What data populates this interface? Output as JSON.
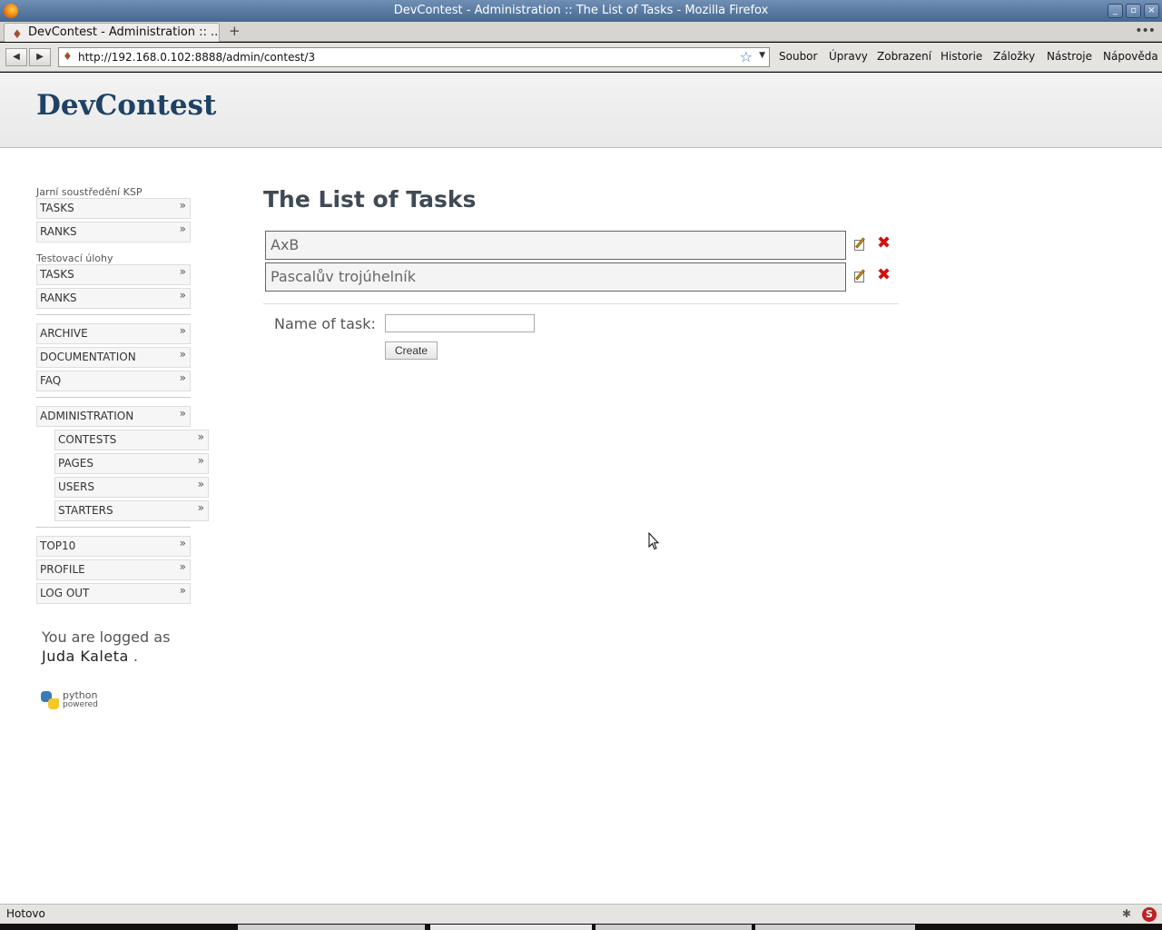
{
  "window": {
    "title": "DevContest - Administration :: The List of Tasks - Mozilla Firefox",
    "buttons": [
      "_",
      "▫",
      "×"
    ]
  },
  "tab": {
    "title": "DevContest - Administration :: ...",
    "new_tab": "+",
    "overflow": "•••"
  },
  "navbar": {
    "back": "◀",
    "forward": "▶",
    "url": "http://192.168.0.102:8888/admin/contest/3",
    "star": "☆",
    "dropdown": "▼",
    "menus": [
      "Soubor",
      "Úpravy",
      "Zobrazení",
      "Historie",
      "Záložky",
      "Nástroje",
      "Nápověda"
    ]
  },
  "site": {
    "logo": "DevContest"
  },
  "sidebar": {
    "section1_label": "Jarní soustředění KSP",
    "section1_items": [
      "TASKS",
      "RANKS"
    ],
    "section2_label": "Testovací úlohy",
    "section2_items": [
      "TASKS",
      "RANKS"
    ],
    "general_items": [
      "ARCHIVE",
      "DOCUMENTATION",
      "FAQ"
    ],
    "admin_item": "ADMINISTRATION",
    "admin_subitems": [
      "CONTESTS",
      "PAGES",
      "USERS",
      "STARTERS"
    ],
    "user_items": [
      "TOP10",
      "PROFILE",
      "LOG OUT"
    ],
    "chevron": "»",
    "logged_prefix": "You are logged as",
    "logged_user": "Juda Kaleta",
    "logged_suffix": ".",
    "python_badge_line1": "python",
    "python_badge_line2": "powered"
  },
  "main": {
    "heading": "The List of Tasks",
    "tasks": [
      "AxB",
      "Pascalův trojúhelník"
    ],
    "delete_glyph": "✖",
    "form_label": "Name of task:",
    "form_value": "",
    "create_label": "Create"
  },
  "statusbar": {
    "text": "Hotovo",
    "icon2": "S"
  }
}
